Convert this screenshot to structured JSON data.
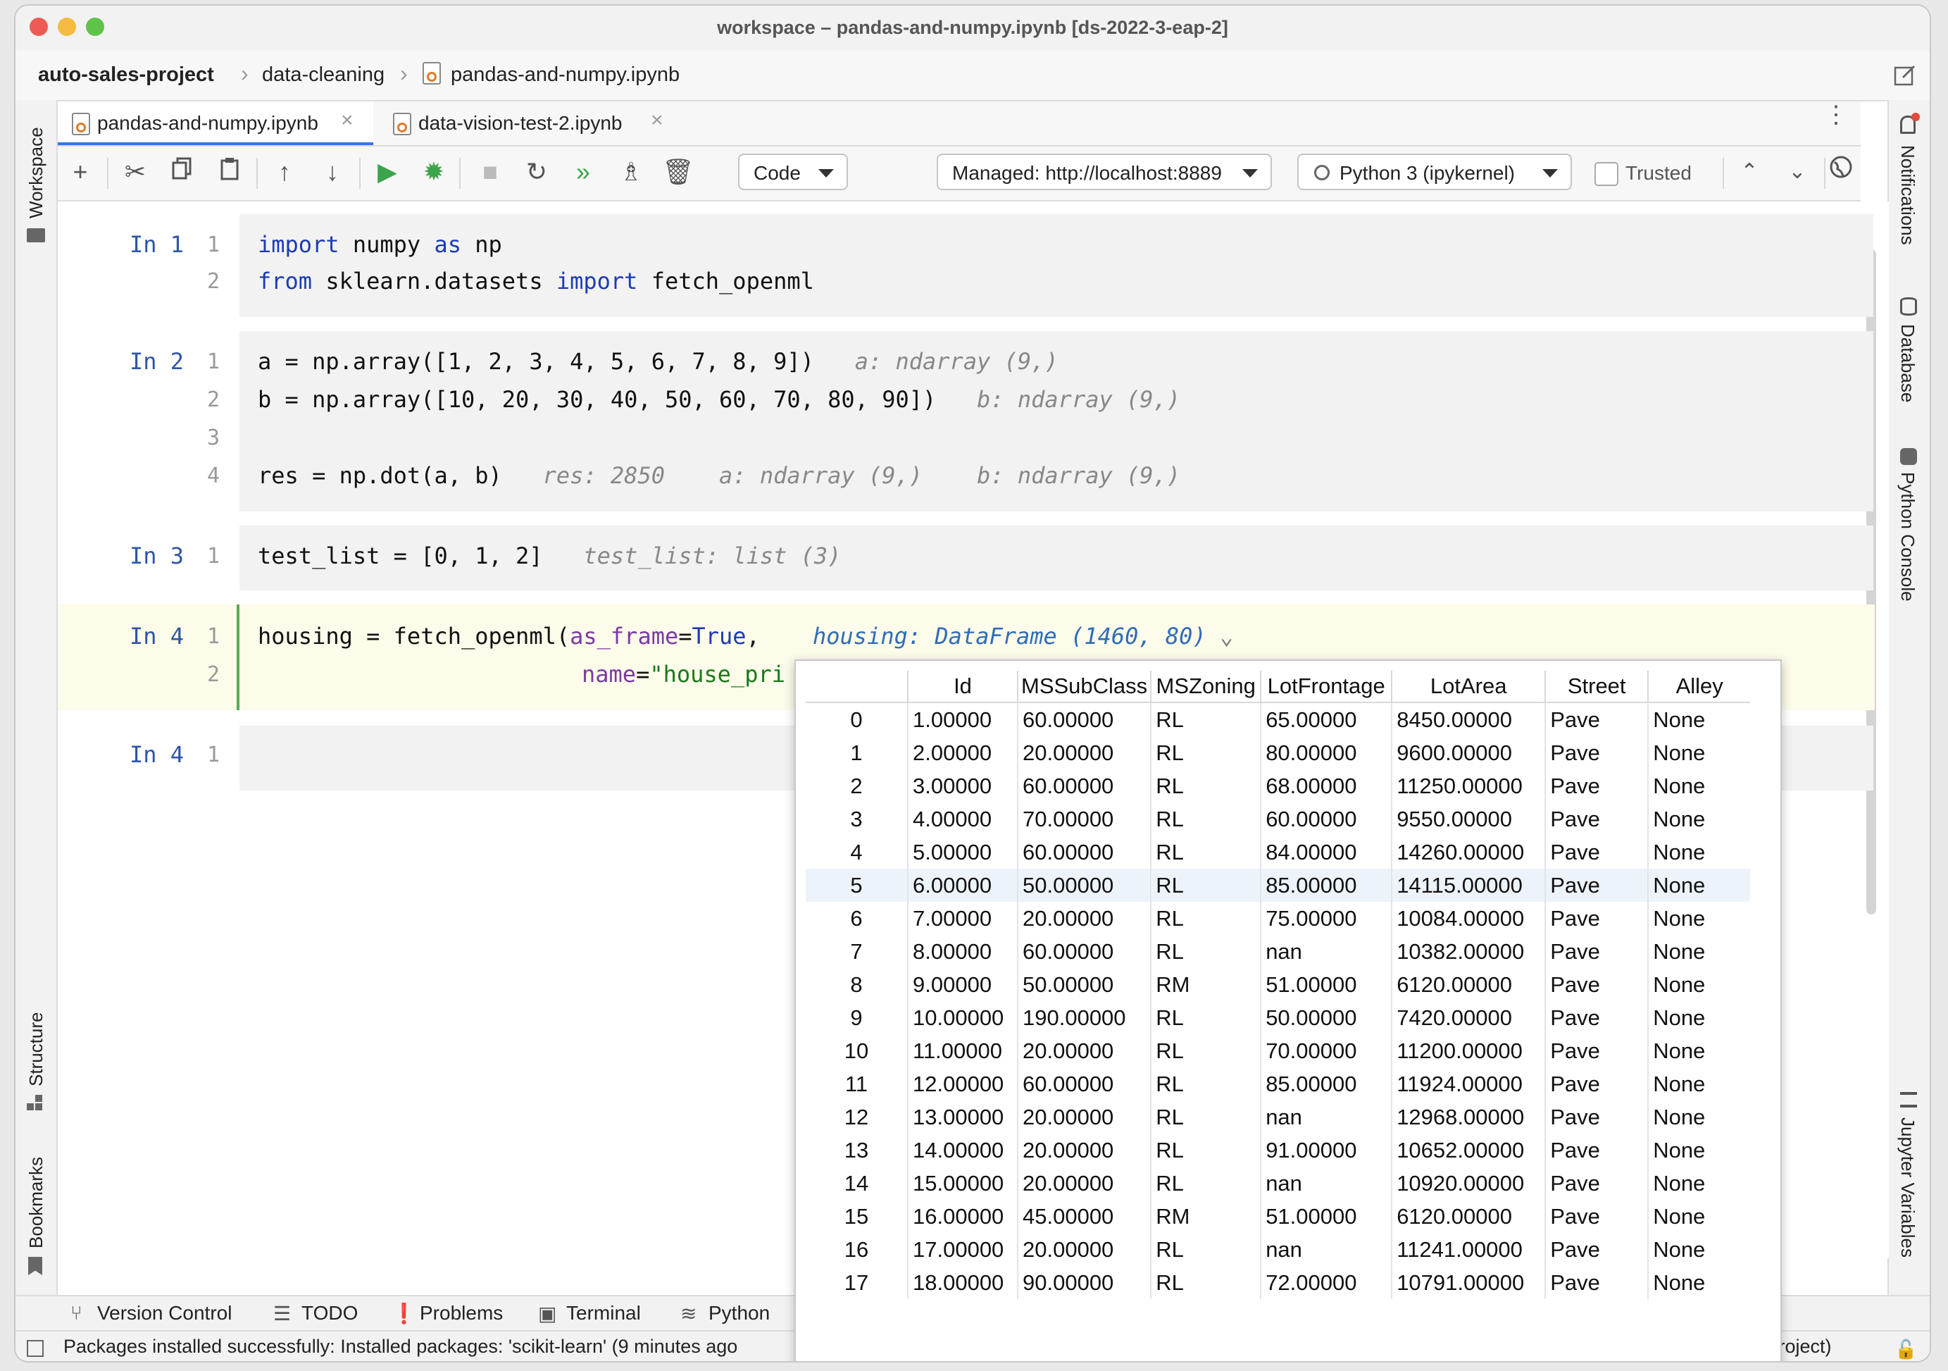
{
  "window": {
    "title": "workspace – pandas-and-numpy.ipynb [ds-2022-3-eap-2]"
  },
  "breadcrumb": {
    "project": "auto-sales-project",
    "folder": "data-cleaning",
    "file": "pandas-and-numpy.ipynb"
  },
  "tabs": [
    {
      "label": "pandas-and-numpy.ipynb",
      "active": true
    },
    {
      "label": "data-vision-test-2.ipynb",
      "active": false
    }
  ],
  "toolbar": {
    "cell_type": "Code",
    "server": "Managed: http://localhost:8889",
    "kernel": "Python 3 (ipykernel)",
    "trusted_label": "Trusted"
  },
  "side_left": {
    "workspace": "Workspace",
    "structure": "Structure",
    "bookmarks": "Bookmarks"
  },
  "side_right": {
    "notifications": "Notifications",
    "database": "Database",
    "python_console": "Python Console",
    "jupyter_variables": "Jupyter Variables"
  },
  "cells": [
    {
      "prompt": "In 1",
      "lines": [
        "1",
        "2"
      ]
    },
    {
      "prompt": "In 2",
      "lines": [
        "1",
        "2",
        "3",
        "4"
      ]
    },
    {
      "prompt": "In 3",
      "lines": [
        "1"
      ]
    },
    {
      "prompt": "In 4",
      "lines": [
        "1",
        "2"
      ]
    },
    {
      "prompt": "In 4",
      "lines": [
        "1"
      ]
    }
  ],
  "code": {
    "c1_l1_kw1": "import",
    "c1_l1_mod": " numpy ",
    "c1_l1_kw2": "as",
    "c1_l1_alias": " np",
    "c1_l2_kw1": "from",
    "c1_l2_mod": " sklearn.datasets ",
    "c1_l2_kw2": "import",
    "c1_l2_name": " fetch_openml",
    "c2_l1": "a = np.array([1, 2, 3, 4, 5, 6, 7, 8, 9])",
    "c2_l1_hint": "a: ndarray (9,)",
    "c2_l2": "b = np.array([10, 20, 30, 40, 50, 60, 70, 80, 90])",
    "c2_l2_hint": "b: ndarray (9,)",
    "c2_l4": "res = np.dot(a, b)",
    "c2_l4_hint1": "res: 2850",
    "c2_l4_hint2": "a: ndarray (9,)",
    "c2_l4_hint3": "b: ndarray (9,)",
    "c3_l1": "test_list = [0, 1, 2]",
    "c3_l1_hint": "test_list: list (3)",
    "c4_l1_a": "housing = fetch_openml(",
    "c4_l1_p": "as_frame",
    "c4_l1_b": "=",
    "c4_l1_kw": "True",
    "c4_l1_c": ",",
    "c4_l1_hint": "housing: DataFrame (1460, 80)",
    "c4_l2_p": "name",
    "c4_l2_b": "=",
    "c4_l2_s": "\"house_pri"
  },
  "dataframe": {
    "columns": [
      "",
      "Id",
      "MSSubClass",
      "MSZoning",
      "LotFrontage",
      "LotArea",
      "Street",
      "Alley"
    ],
    "rows": [
      [
        "0",
        "1.00000",
        "60.00000",
        "RL",
        "65.00000",
        "8450.00000",
        "Pave",
        "None"
      ],
      [
        "1",
        "2.00000",
        "20.00000",
        "RL",
        "80.00000",
        "9600.00000",
        "Pave",
        "None"
      ],
      [
        "2",
        "3.00000",
        "60.00000",
        "RL",
        "68.00000",
        "11250.00000",
        "Pave",
        "None"
      ],
      [
        "3",
        "4.00000",
        "70.00000",
        "RL",
        "60.00000",
        "9550.00000",
        "Pave",
        "None"
      ],
      [
        "4",
        "5.00000",
        "60.00000",
        "RL",
        "84.00000",
        "14260.00000",
        "Pave",
        "None"
      ],
      [
        "5",
        "6.00000",
        "50.00000",
        "RL",
        "85.00000",
        "14115.00000",
        "Pave",
        "None"
      ],
      [
        "6",
        "7.00000",
        "20.00000",
        "RL",
        "75.00000",
        "10084.00000",
        "Pave",
        "None"
      ],
      [
        "7",
        "8.00000",
        "60.00000",
        "RL",
        "nan",
        "10382.00000",
        "Pave",
        "None"
      ],
      [
        "8",
        "9.00000",
        "50.00000",
        "RM",
        "51.00000",
        "6120.00000",
        "Pave",
        "None"
      ],
      [
        "9",
        "10.00000",
        "190.00000",
        "RL",
        "50.00000",
        "7420.00000",
        "Pave",
        "None"
      ],
      [
        "10",
        "11.00000",
        "20.00000",
        "RL",
        "70.00000",
        "11200.00000",
        "Pave",
        "None"
      ],
      [
        "11",
        "12.00000",
        "60.00000",
        "RL",
        "85.00000",
        "11924.00000",
        "Pave",
        "None"
      ],
      [
        "12",
        "13.00000",
        "20.00000",
        "RL",
        "nan",
        "12968.00000",
        "Pave",
        "None"
      ],
      [
        "13",
        "14.00000",
        "20.00000",
        "RL",
        "91.00000",
        "10652.00000",
        "Pave",
        "None"
      ],
      [
        "14",
        "15.00000",
        "20.00000",
        "RL",
        "nan",
        "10920.00000",
        "Pave",
        "None"
      ],
      [
        "15",
        "16.00000",
        "45.00000",
        "RM",
        "51.00000",
        "6120.00000",
        "Pave",
        "None"
      ],
      [
        "16",
        "17.00000",
        "20.00000",
        "RL",
        "nan",
        "11241.00000",
        "Pave",
        "None"
      ],
      [
        "17",
        "18.00000",
        "90.00000",
        "RL",
        "72.00000",
        "10791.00000",
        "Pave",
        "None"
      ]
    ],
    "selected_row": 5
  },
  "bottom_tools": [
    "Version Control",
    "TODO",
    "Problems",
    "Terminal",
    "Python"
  ],
  "status": {
    "message": "Packages installed successfully: Installed packages: 'scikit-learn' (9 minutes ago",
    "right": "ales-project)"
  }
}
